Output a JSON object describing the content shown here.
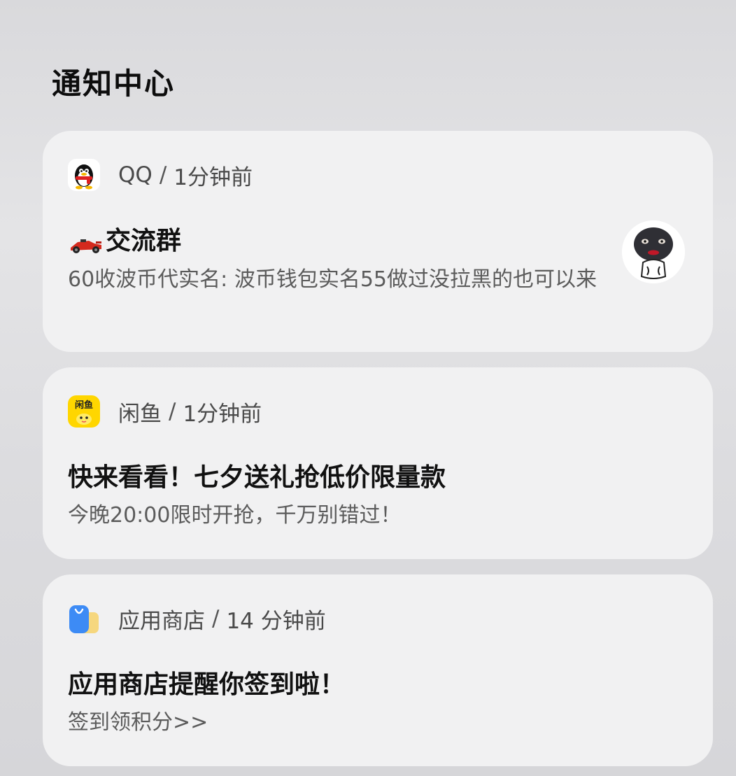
{
  "page": {
    "title": "通知中心"
  },
  "notifications": [
    {
      "app_name": "QQ",
      "separator": "/",
      "time": "1分钟前",
      "title": "交流群",
      "title_prefix_icon": "race-car-icon",
      "body": "60收波币代实名: 波币钱包实名55做过没拉黑的也可以来",
      "app_icon": "qq-penguin-icon",
      "avatar": "sticker-avatar"
    },
    {
      "app_name": "闲鱼",
      "separator": "/",
      "time": "1分钟前",
      "title": "快来看看！七夕送礼抢低价限量款",
      "body": "今晚20:00限时开抢，千万别错过！",
      "app_icon": "xianyu-icon",
      "app_icon_text": "闲鱼"
    },
    {
      "app_name": "应用商店",
      "separator": "/",
      "time": "14 分钟前",
      "title": "应用商店提醒你签到啦！",
      "body": "签到领积分>>",
      "app_icon": "app-store-bag-icon"
    }
  ],
  "colors": {
    "background": "#dcdcdf",
    "card": "#f1f1f2",
    "title_text": "#111111",
    "meta_text": "#4a4a4a",
    "body_text": "#5b5b5b",
    "qq_red": "#e02020",
    "xianyu_yellow": "#ffd600",
    "store_blue": "#3d8bf5",
    "store_yellow": "#f6d77e"
  }
}
